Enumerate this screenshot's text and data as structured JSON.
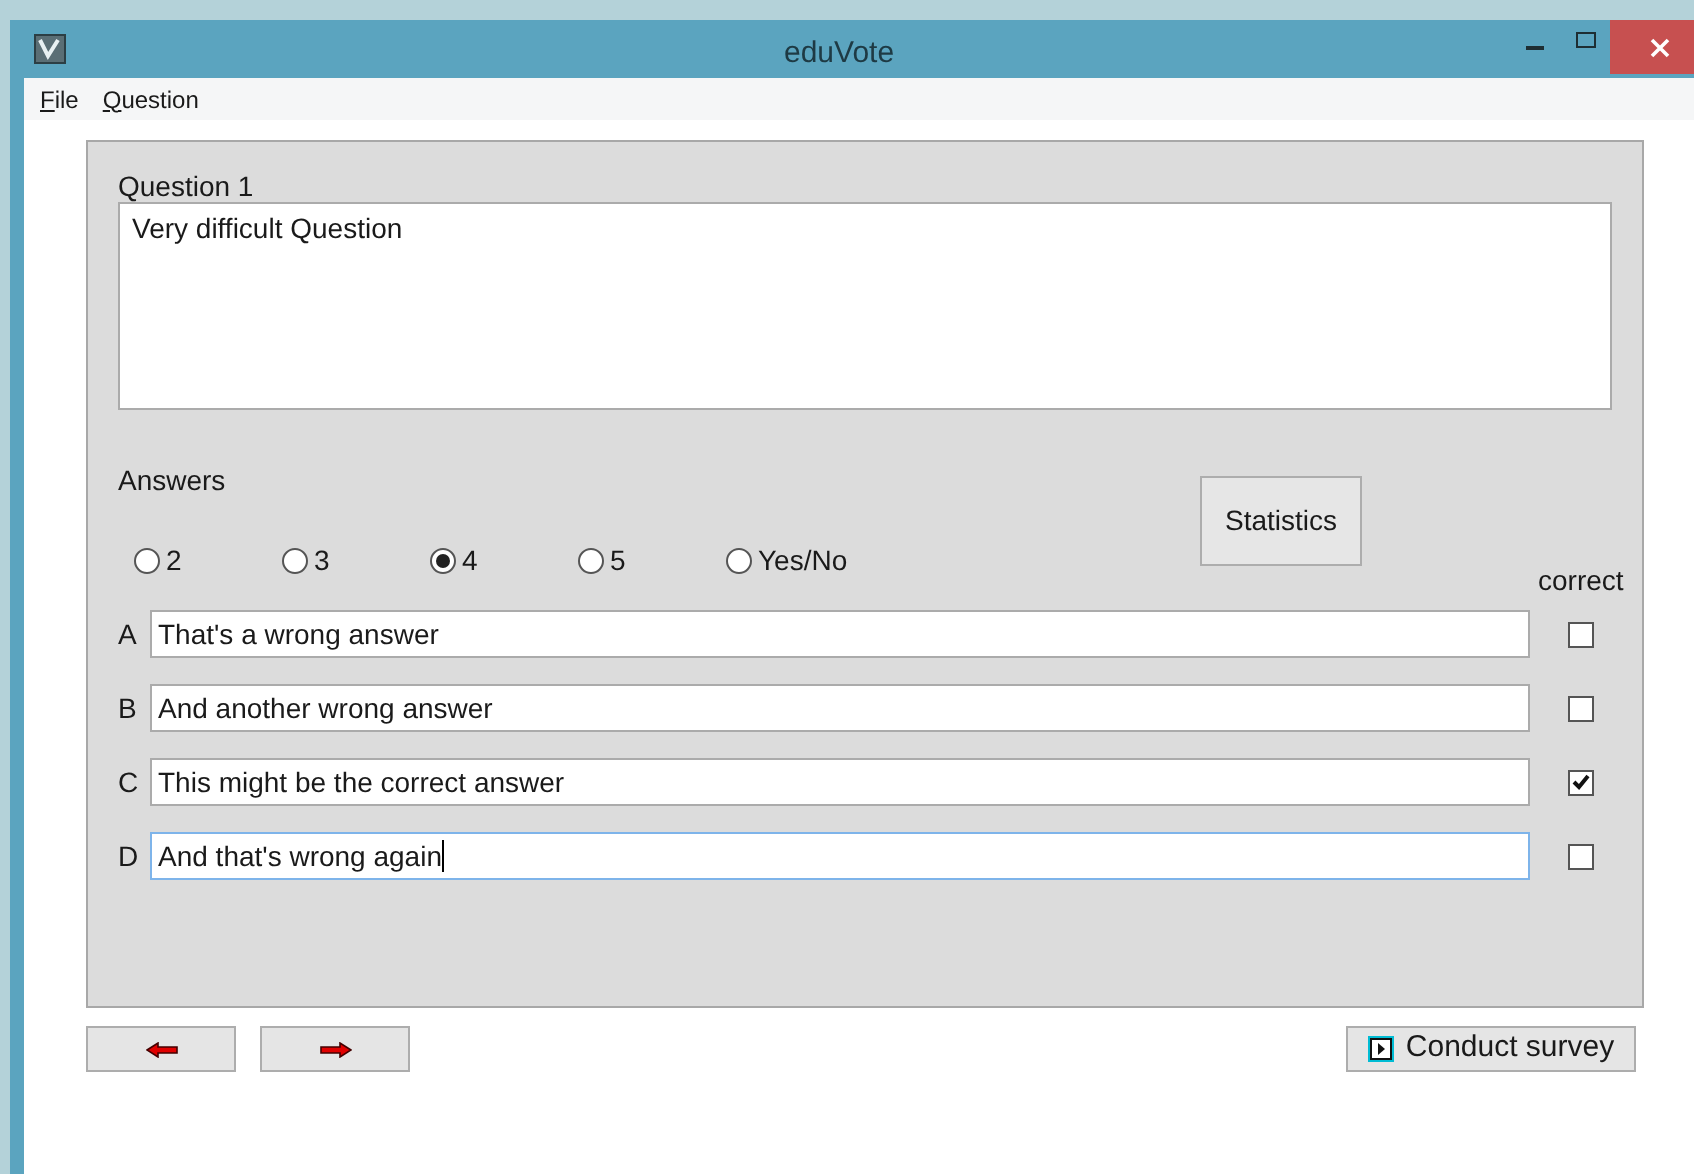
{
  "window": {
    "title": "eduVote"
  },
  "menu": [
    {
      "label": "File"
    },
    {
      "label": "Question"
    }
  ],
  "question": {
    "label": "Question 1",
    "text": "Very difficult Question"
  },
  "answers_label": "Answers",
  "answer_counts": [
    {
      "label": "2",
      "selected": false
    },
    {
      "label": "3",
      "selected": false
    },
    {
      "label": "4",
      "selected": true
    },
    {
      "label": "5",
      "selected": false
    },
    {
      "label": "Yes/No",
      "selected": false
    }
  ],
  "statistics_button": "Statistics",
  "correct_label": "correct",
  "answers": [
    {
      "letter": "A",
      "text": "That's a wrong answer",
      "focused": false,
      "correct": false
    },
    {
      "letter": "B",
      "text": "And another wrong answer",
      "focused": false,
      "correct": false
    },
    {
      "letter": "C",
      "text": "This might be the correct answer",
      "focused": false,
      "correct": true
    },
    {
      "letter": "D",
      "text": "And that's wrong again",
      "focused": true,
      "correct": false
    }
  ],
  "conduct_button": "Conduct survey"
}
